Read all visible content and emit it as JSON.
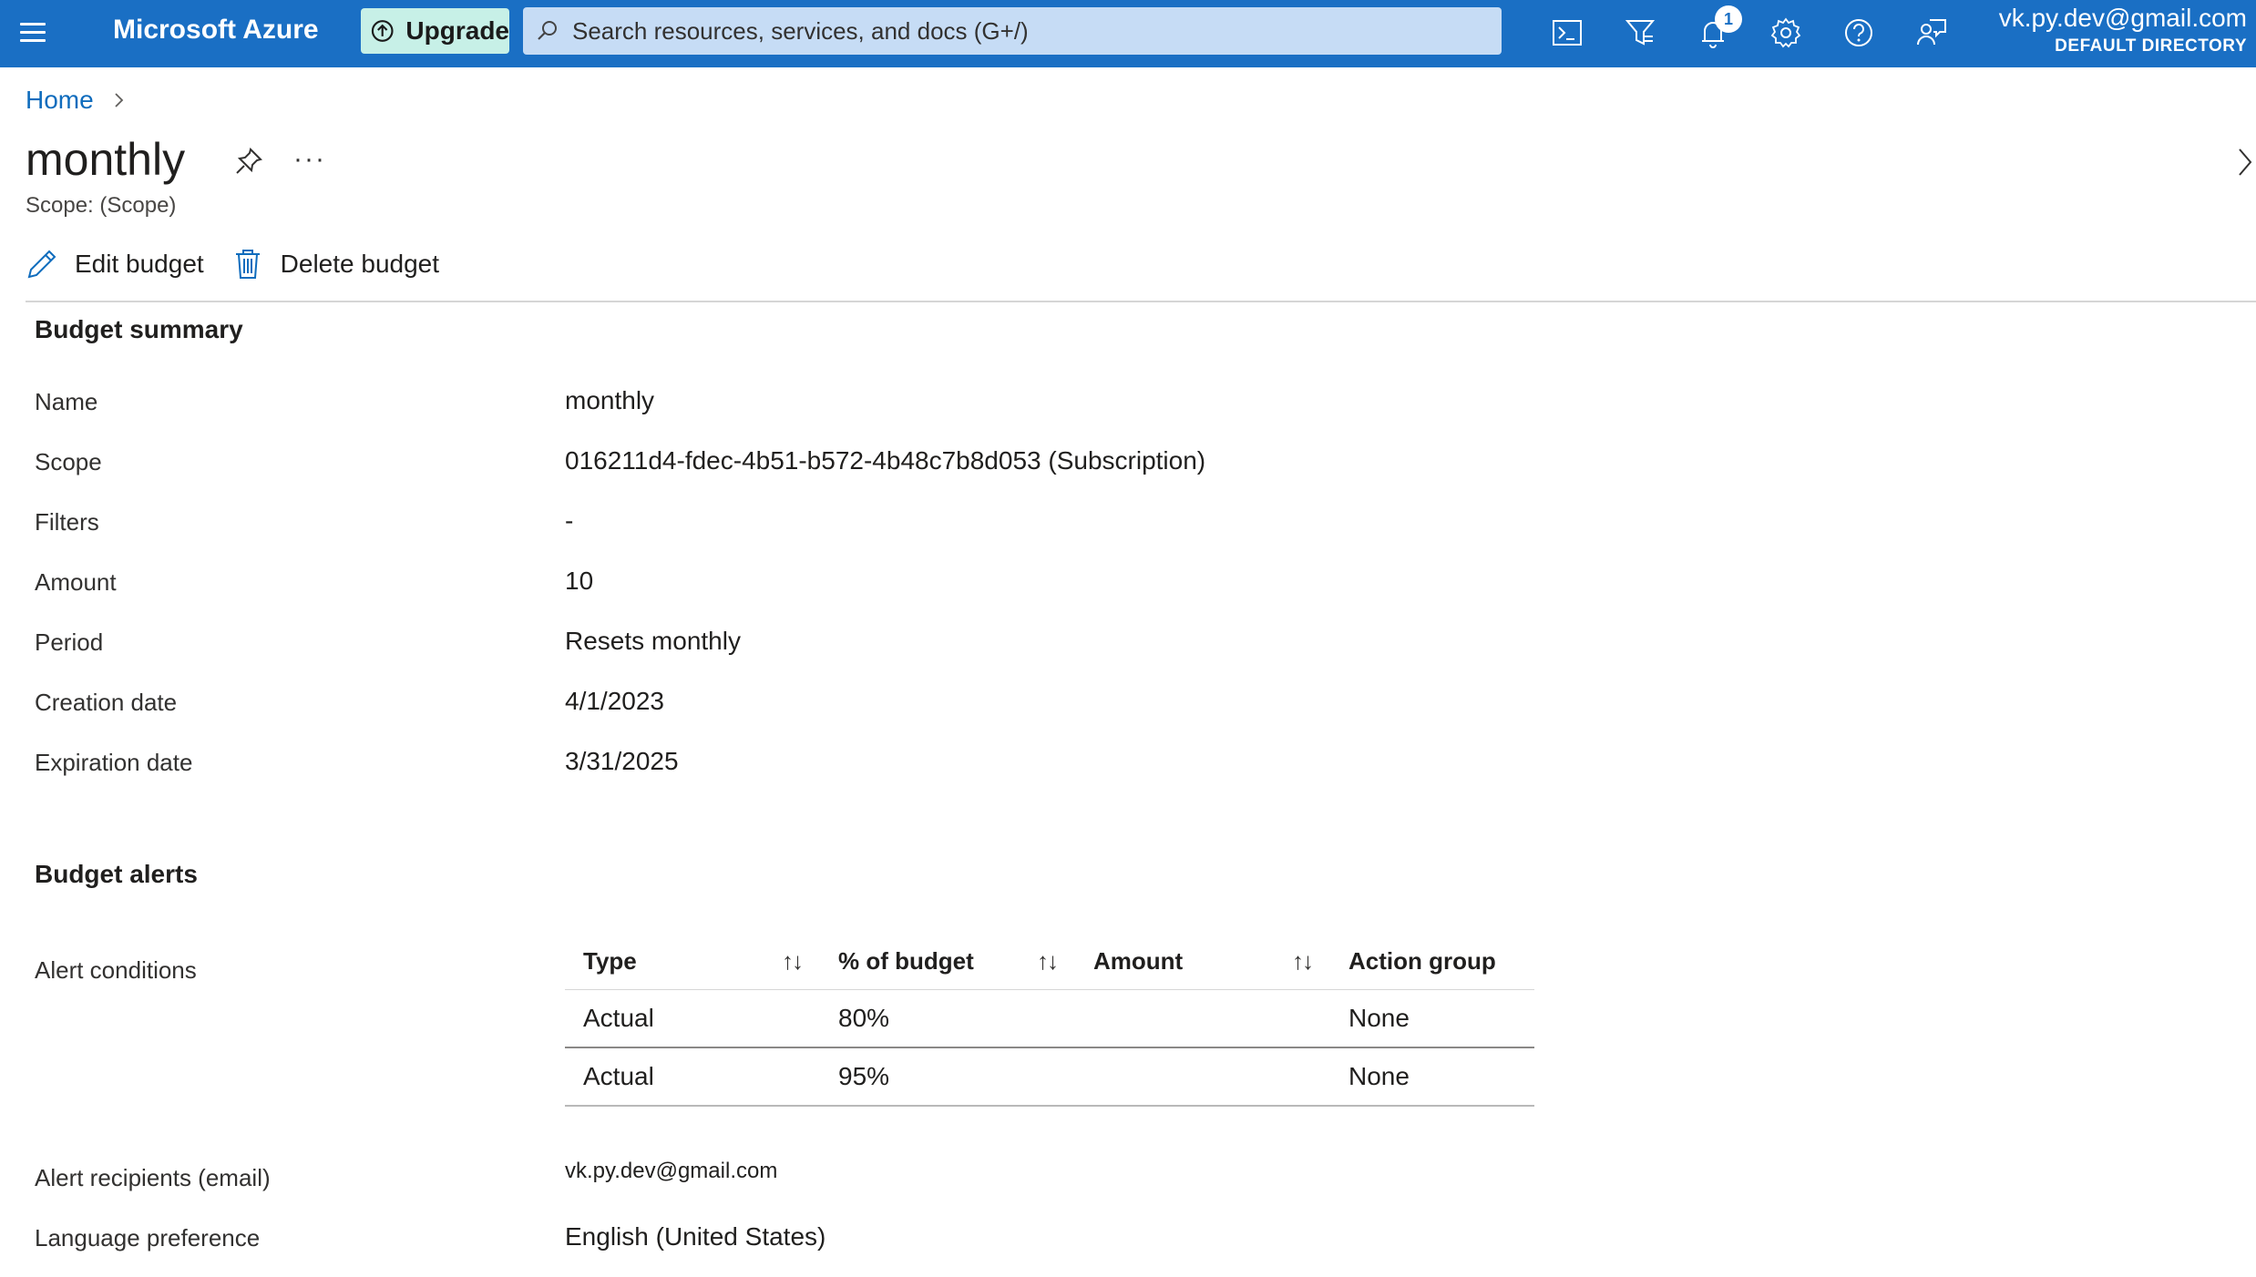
{
  "topbar": {
    "brand": "Microsoft Azure",
    "upgrade_label": "Upgrade",
    "search_placeholder": "Search resources, services, and docs (G+/)",
    "notification_count": "1",
    "account_email": "vk.py.dev@gmail.com",
    "account_directory": "DEFAULT DIRECTORY",
    "bar_color": "#1a6fc4",
    "upgrade_color": "#c7f0e7",
    "icons": [
      "menu-icon",
      "upgrade-icon",
      "search-icon",
      "cloud-shell-icon",
      "directory-filter-icon",
      "notifications-icon",
      "settings-icon",
      "help-icon",
      "feedback-icon"
    ]
  },
  "breadcrumb": {
    "home": "Home"
  },
  "header": {
    "title": "monthly",
    "subtitle": "Scope: (Scope)",
    "more": "···"
  },
  "toolbar": {
    "edit_label": "Edit budget",
    "delete_label": "Delete budget"
  },
  "summary": {
    "heading": "Budget summary",
    "rows": [
      {
        "label": "Name",
        "value": "monthly"
      },
      {
        "label": "Scope",
        "value": "016211d4-fdec-4b51-b572-4b48c7b8d053 (Subscription)"
      },
      {
        "label": "Filters",
        "value": "-"
      },
      {
        "label": "Amount",
        "value": "10"
      },
      {
        "label": "Period",
        "value": "Resets monthly"
      },
      {
        "label": "Creation date",
        "value": "4/1/2023"
      },
      {
        "label": "Expiration date",
        "value": "3/31/2025"
      }
    ]
  },
  "alerts": {
    "heading": "Budget alerts",
    "conditions_label": "Alert conditions",
    "columns": [
      "Type",
      "% of budget",
      "Amount",
      "Action group"
    ],
    "rows": [
      {
        "type": "Actual",
        "percent": "80%",
        "amount": "",
        "action_group": "None"
      },
      {
        "type": "Actual",
        "percent": "95%",
        "amount": "",
        "action_group": "None"
      }
    ],
    "recipients_label": "Alert recipients (email)",
    "recipients_value": "vk.py.dev@gmail.com",
    "language_label": "Language preference",
    "language_value": "English (United States)"
  }
}
